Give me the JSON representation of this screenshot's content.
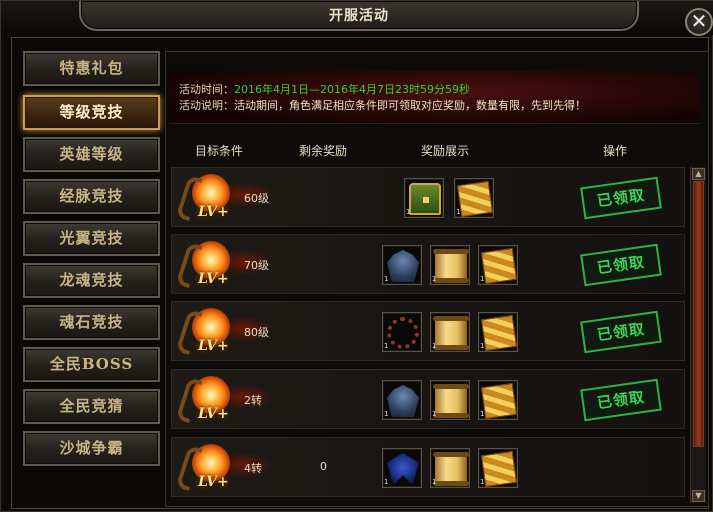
{
  "window": {
    "title": "开服活动",
    "close_label": "✕"
  },
  "sidebar": {
    "items": [
      {
        "label": "特惠礼包",
        "active": false
      },
      {
        "label": "等级竞技",
        "active": true
      },
      {
        "label": "英雄等级",
        "active": false
      },
      {
        "label": "经脉竞技",
        "active": false
      },
      {
        "label": "光翼竞技",
        "active": false
      },
      {
        "label": "龙魂竞技",
        "active": false
      },
      {
        "label": "魂石竞技",
        "active": false
      },
      {
        "label": "全民BOSS",
        "active": false
      },
      {
        "label": "全民竞猜",
        "active": false
      },
      {
        "label": "沙城争霸",
        "active": false
      }
    ]
  },
  "info": {
    "time_label": "活动时间：",
    "time_value": "2016年4月1日—2016年4月7日23时59分59秒",
    "desc_label": "活动说明：",
    "desc_value": "活动期间，角色满足相应条件即可领取对应奖励，数量有限，先到先得！"
  },
  "headers": {
    "condition": "目标条件",
    "remaining": "剩余奖励",
    "rewards": "奖励展示",
    "action": "操作"
  },
  "rows": [
    {
      "condition": "60级",
      "remaining": "",
      "status": "已领取",
      "rewards": [
        {
          "icon": "treasure-chest-icon",
          "qty": "1"
        },
        {
          "icon": "ticket-bundle-icon",
          "qty": "1"
        }
      ]
    },
    {
      "condition": "70级",
      "remaining": "",
      "status": "已领取",
      "rewards": [
        {
          "icon": "armor-icon",
          "qty": "1"
        },
        {
          "icon": "scroll-icon",
          "qty": "1"
        },
        {
          "icon": "ticket-bundle-icon",
          "qty": "1"
        }
      ]
    },
    {
      "condition": "80级",
      "remaining": "",
      "status": "已领取",
      "rewards": [
        {
          "icon": "necklace-icon",
          "qty": "1"
        },
        {
          "icon": "scroll-icon",
          "qty": "1"
        },
        {
          "icon": "ticket-bundle-icon",
          "qty": "1"
        }
      ]
    },
    {
      "condition": "2转",
      "remaining": "",
      "status": "已领取",
      "rewards": [
        {
          "icon": "armor-icon",
          "qty": "1"
        },
        {
          "icon": "scroll-icon",
          "qty": "1"
        },
        {
          "icon": "ticket-bundle-icon",
          "qty": "1"
        }
      ]
    },
    {
      "condition": "4转",
      "remaining": "0",
      "status": "",
      "rewards": [
        {
          "icon": "wings-icon",
          "qty": "1"
        },
        {
          "icon": "scroll-icon",
          "qty": "1"
        },
        {
          "icon": "ticket-bundle-icon",
          "qty": "1"
        }
      ]
    }
  ],
  "badge_text": "LV+",
  "colors": {
    "accent": "#c89d5a",
    "time_text": "#35d13a",
    "stamp": "#3ad457",
    "info_bg": "#2a0707"
  }
}
